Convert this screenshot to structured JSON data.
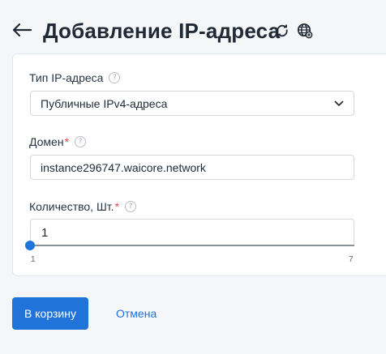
{
  "header": {
    "title": "Добавление IP-адреса",
    "back_icon": "arrow-left-icon",
    "refresh_icon": "refresh-icon",
    "globe_icon": "globe-icon"
  },
  "form": {
    "ip_type": {
      "label": "Тип IP-адреса",
      "selected": "Публичные IPv4-адреса",
      "help_icon": "question-icon"
    },
    "domain": {
      "label": "Домен",
      "required_mark": "*",
      "value": "instance296747.waicore.network",
      "help_icon": "question-icon"
    },
    "quantity": {
      "label": "Количество, Шт.",
      "required_mark": "*",
      "value": "1",
      "min": "1",
      "max": "7",
      "help_icon": "question-icon"
    }
  },
  "actions": {
    "submit_label": "В корзину",
    "cancel_label": "Отмена"
  },
  "colors": {
    "accent": "#1f73d9",
    "required": "#e5484d",
    "background": "#f5f6f8"
  }
}
